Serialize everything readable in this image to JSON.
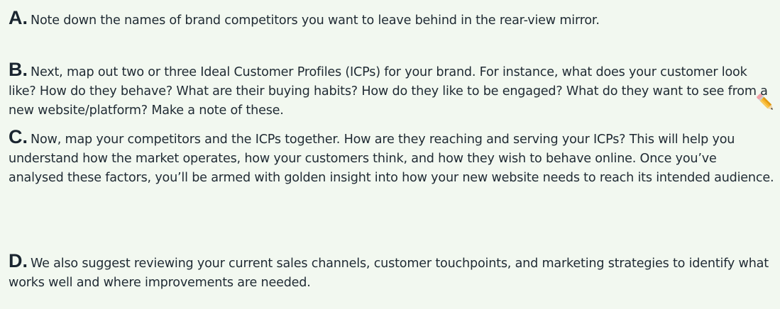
{
  "steps": [
    {
      "letter": "A.",
      "text": "Note down the names of brand competitors you want to leave behind in the rear-view mirror."
    },
    {
      "letter": "B.",
      "text": "Next, map out two or three Ideal Customer Profiles (ICPs) for your brand. For instance, what does your customer look like? How do they behave? What are their buying habits? How do they like to be engaged? What do they want to see from a new website/platform? Make a note of these."
    },
    {
      "letter": "C.",
      "text": "Now, map your competitors and the ICPs together. How are they reaching and serving your ICPs? This will help you understand how the market operates, how your customers think, and how they wish to behave online. Once you’ve analysed these factors, you’ll be armed with golden insight into how your new website needs to reach its intended audience."
    },
    {
      "letter": "D.",
      "text": "We also suggest reviewing your current sales channels, customer touchpoints, and marketing strategies to identify what works well and where improvements are needed."
    }
  ],
  "icons": {
    "note": "pencil-icon"
  },
  "colors": {
    "background": "#f2f8f0",
    "text": "#1f2a33"
  }
}
